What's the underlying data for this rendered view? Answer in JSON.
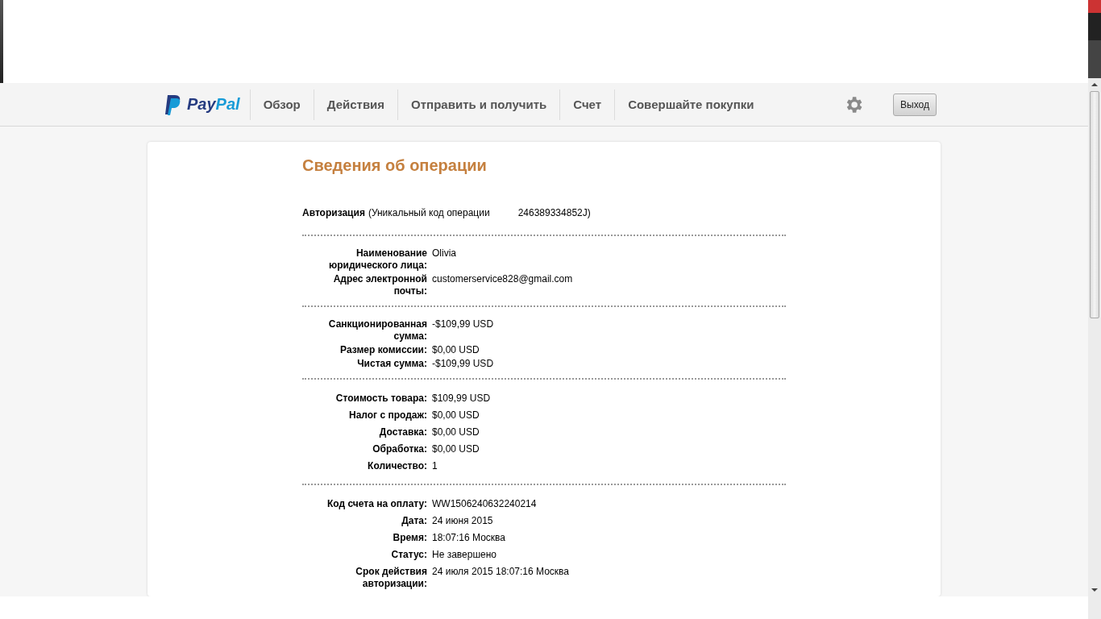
{
  "nav": {
    "logo_parts": [
      "Pay",
      "Pal"
    ],
    "items": [
      {
        "label": "Обзор",
        "selected": false
      },
      {
        "label": "Действия",
        "selected": false
      },
      {
        "label": "Отправить и получить",
        "selected": false
      },
      {
        "label": "Счет",
        "selected": false
      },
      {
        "label": "Совершайте покупки",
        "selected": false
      }
    ],
    "logout": "Выход"
  },
  "title": "Сведения об операции",
  "authorization": {
    "label": "Авторизация",
    "text": "(Уникальный код операции",
    "code": "246389334852J)"
  },
  "sections": [
    {
      "rows": [
        {
          "label": "Наименование юридического лица:",
          "value": "Olivia"
        },
        {
          "label": "Адрес электронной почты:",
          "value": "customerservice828@gmail.com"
        }
      ]
    },
    {
      "rows": [
        {
          "label": "Санкционированная сумма:",
          "value": "-$109,99 USD"
        },
        {
          "label": "Размер комиссии:",
          "value": "$0,00 USD"
        },
        {
          "label": "Чистая сумма:",
          "value": "-$109,99 USD"
        }
      ]
    },
    {
      "rows": [
        {
          "label": "Стоимость товара:",
          "value": "$109,99 USD"
        },
        {
          "label": "Налог с продаж:",
          "value": "$0,00 USD"
        },
        {
          "label": "Доставка:",
          "value": "$0,00 USD"
        },
        {
          "label": "Обработка:",
          "value": "$0,00 USD"
        },
        {
          "label": "Количество:",
          "value": "1"
        }
      ]
    },
    {
      "rows": [
        {
          "label": "Код счета на оплату:",
          "value": "WW1506240632240214"
        },
        {
          "label": "Дата:",
          "value": "24 июня 2015"
        },
        {
          "label": "Время:",
          "value": "18:07:16 Москва"
        },
        {
          "label": "Статус:",
          "value": "Не завершено"
        },
        {
          "label": "Срок действия авторизации:",
          "value": "24 июля 2015 18:07:16 Москва"
        }
      ]
    }
  ]
}
